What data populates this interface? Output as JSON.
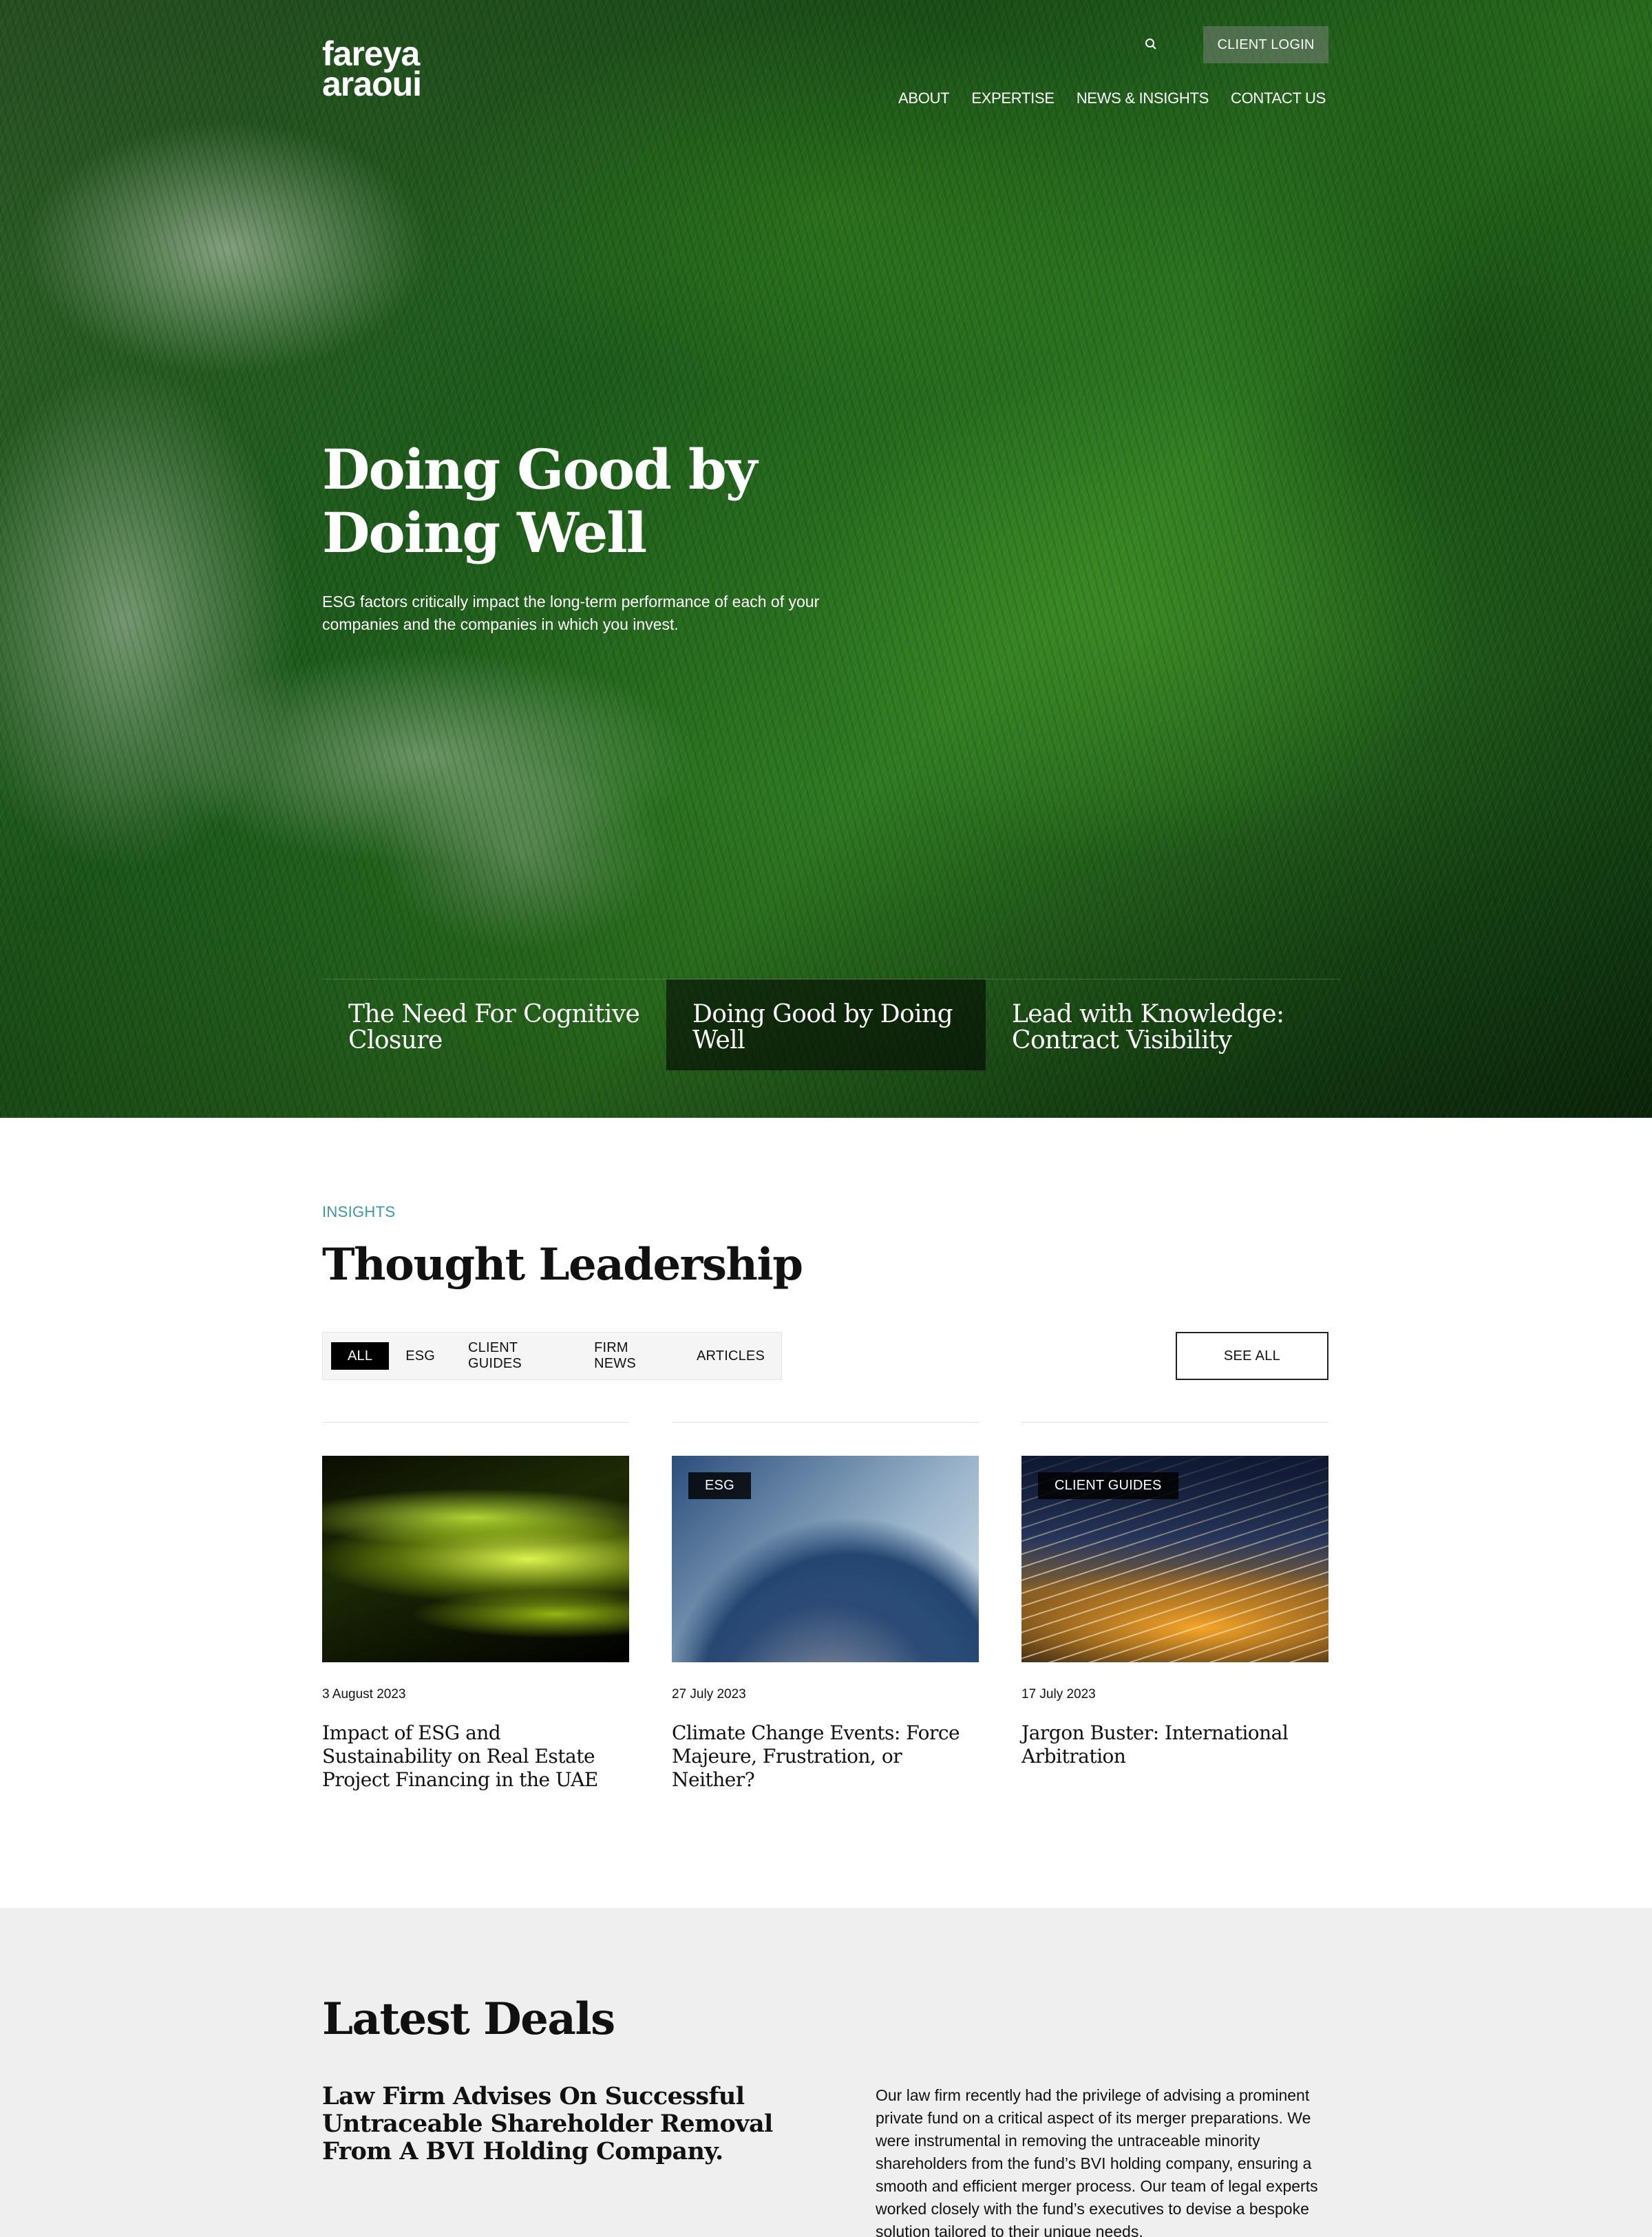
{
  "header": {
    "logo_line1": "fareya",
    "logo_line2": "araoui",
    "search_icon": "search-icon",
    "client_login": "CLIENT LOGIN",
    "nav": [
      "ABOUT",
      "EXPERTISE",
      "NEWS & INSIGHTS",
      "CONTACT US"
    ]
  },
  "hero": {
    "title": "Doing Good by Doing Well",
    "subtitle": "ESG factors critically impact the long-term performance of each of your companies and the companies in which you invest.",
    "slides": [
      "The Need For Cognitive Closure",
      "Doing Good by Doing Well",
      "Lead with Knowledge: Contract Visibility"
    ],
    "active_slide": 1
  },
  "insights": {
    "eyebrow": "INSIGHTS",
    "title": "Thought Leadership",
    "filters": [
      "ALL",
      "ESG",
      "CLIENT GUIDES",
      "FIRM NEWS",
      "ARTICLES"
    ],
    "active_filter": "ALL",
    "see_all": "SEE ALL",
    "cards": [
      {
        "tag": "",
        "date": "3 August 2023",
        "title": "Impact of ESG and Sustainability on Real Estate Project Financing in the UAE"
      },
      {
        "tag": "ESG",
        "date": "27 July 2023",
        "title": "Climate Change Events: Force Majeure, Frustration, or Neither?"
      },
      {
        "tag": "CLIENT GUIDES",
        "date": "17 July 2023",
        "title": "Jargon Buster: International Arbitration"
      }
    ]
  },
  "deals": {
    "title": "Latest Deals",
    "headline": "Law Firm Advises On Successful Untraceable Shareholder Removal From A BVI Holding Company.",
    "body": "Our law firm recently had the privilege of advising a prominent private fund on a critical aspect of its merger preparations. We were instrumental in removing the untraceable minority shareholders from the fund’s BVI holding company, ensuring a smooth and efficient merger process. Our team of legal experts worked closely with the fund’s executives to devise a bespoke solution tailored to their unique needs."
  }
}
